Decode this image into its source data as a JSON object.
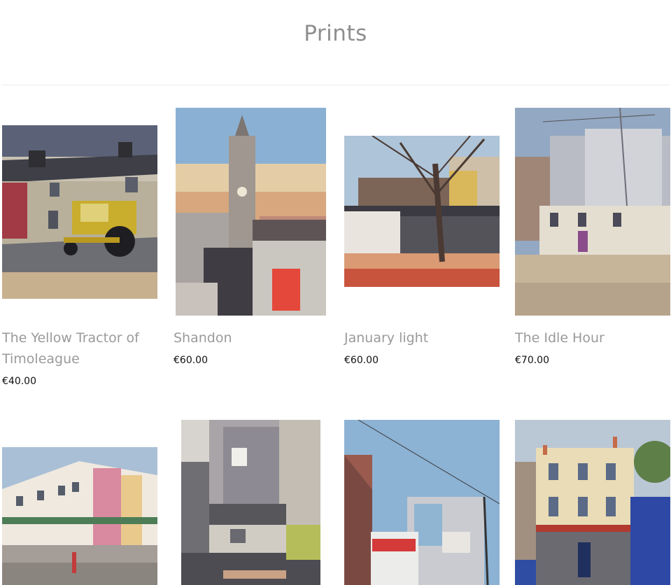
{
  "page": {
    "title": "Prints"
  },
  "products": [
    {
      "title": "The Yellow Tractor of Timoleague",
      "price": "€40.00",
      "image": "painting-yellow-tractor"
    },
    {
      "title": "Shandon",
      "price": "€60.00",
      "image": "painting-shandon-tower"
    },
    {
      "title": "January light",
      "price": "€60.00",
      "image": "painting-january-light"
    },
    {
      "title": "The Idle Hour",
      "price": "€70.00",
      "image": "painting-idle-hour"
    },
    {
      "image": "painting-corner-building"
    },
    {
      "image": "painting-grey-buildings"
    },
    {
      "image": "painting-shopfront-street"
    },
    {
      "image": "painting-cream-pub"
    }
  ]
}
